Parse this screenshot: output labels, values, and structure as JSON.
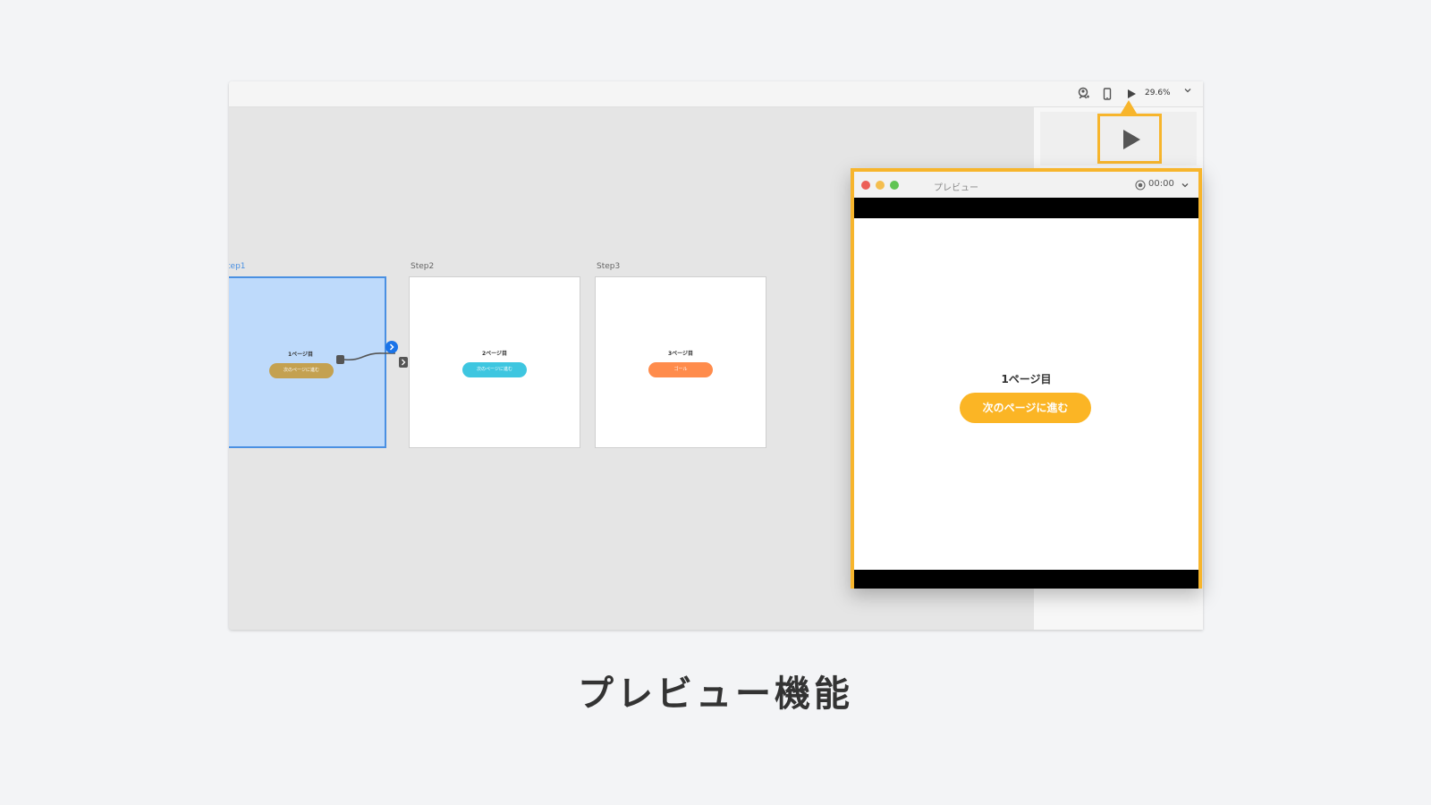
{
  "toolbar": {
    "zoom": "29.6%",
    "icons": [
      "user-share-icon",
      "device-icon",
      "play-icon",
      "chevron-down-icon"
    ]
  },
  "artboards": [
    {
      "label": "tep1",
      "title": "1ページ目",
      "button": "次のページに進む",
      "button_color": "#c4a150",
      "selected": true
    },
    {
      "label": "Step2",
      "title": "2ページ目",
      "button": "次のページに進む",
      "button_color": "#3ec6e0",
      "selected": false
    },
    {
      "label": "Step3",
      "title": "3ページ目",
      "button": "ゴール",
      "button_color": "#ff8c4c",
      "selected": false
    }
  ],
  "preview": {
    "window_title": "プレビュー",
    "time": "00:00",
    "heading": "1ページ目",
    "button": "次のページに進む",
    "button_color": "#fbb525"
  },
  "highlight_color": "#f7b52c",
  "caption": "プレビュー機能"
}
